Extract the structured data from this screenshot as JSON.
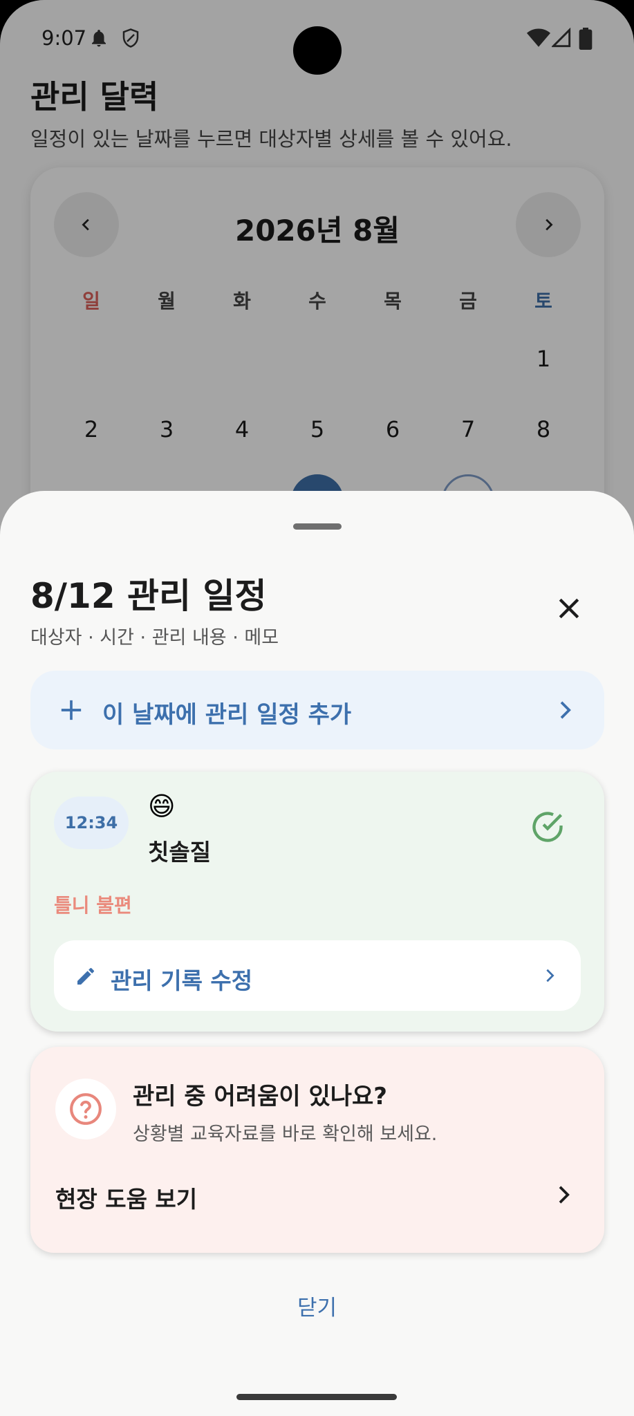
{
  "status_bar": {
    "time": "9:07",
    "icons": [
      "bell-icon",
      "shield-icon",
      "wifi-icon",
      "signal-icon",
      "battery-icon"
    ]
  },
  "page": {
    "title": "관리 달력",
    "subtitle": "일정이 있는 날짜를 누르면 대상자별 상세를 볼 수 있어요."
  },
  "calendar": {
    "month_label": "2026년 8월",
    "weekdays": [
      "일",
      "월",
      "화",
      "수",
      "목",
      "금",
      "토"
    ],
    "week1": [
      "1"
    ],
    "week2": [
      "2",
      "3",
      "4",
      "5",
      "6",
      "7",
      "8"
    ],
    "sunday_color": "#d9605a",
    "saturday_color": "#3d6ea6"
  },
  "sheet": {
    "title": "8/12 관리 일정",
    "subtitle": "대상자 · 시간 · 관리 내용 · 메모",
    "add_label": "이 날짜에 관리 일정 추가",
    "schedule": {
      "time": "12:34",
      "emoji": "😄",
      "activity": "칫솔질",
      "note": "틀니 불편",
      "edit_label": "관리 기록 수정"
    },
    "help": {
      "title": "관리 중 어려움이 있나요?",
      "subtitle": "상황별 교육자료를 바로 확인해 보세요.",
      "link_label": "현장 도움 보기"
    },
    "close_label": "닫기"
  },
  "colors": {
    "accent": "#3d70ad",
    "success": "#5fa468",
    "warning_text": "#ea8a7c",
    "help_icon": "#e8877c"
  }
}
